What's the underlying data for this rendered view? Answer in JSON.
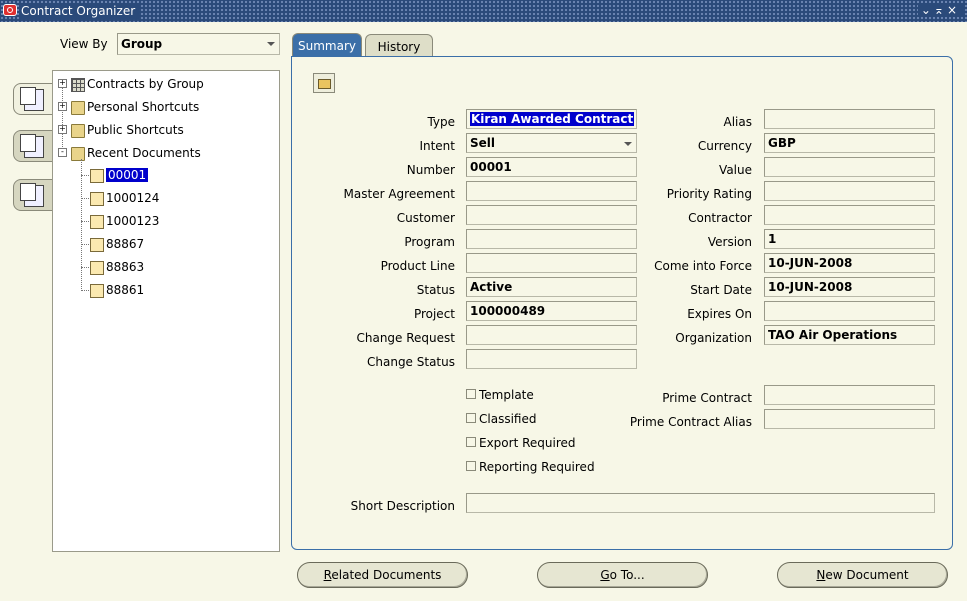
{
  "window": {
    "title": "Contract Organizer",
    "controls": "⌄⌅×"
  },
  "view_by": {
    "label": "View By",
    "value": "Group"
  },
  "tree": {
    "roots": [
      {
        "label": "Contracts by Group"
      },
      {
        "label": "Personal Shortcuts"
      },
      {
        "label": "Public Shortcuts"
      },
      {
        "label": "Recent Documents"
      }
    ],
    "recent": [
      "00001",
      "1000124",
      "1000123",
      "88867",
      "88863",
      "88861"
    ]
  },
  "tabs": {
    "summary": "Summary",
    "history": "History"
  },
  "left_fields": {
    "type": {
      "label": "Type",
      "value": "Kiran Awarded Contract"
    },
    "intent": {
      "label": "Intent",
      "value": "Sell"
    },
    "number": {
      "label": "Number",
      "value": "00001"
    },
    "master_agreement": {
      "label": "Master Agreement",
      "value": ""
    },
    "customer": {
      "label": "Customer",
      "value": ""
    },
    "program": {
      "label": "Program",
      "value": ""
    },
    "product_line": {
      "label": "Product Line",
      "value": ""
    },
    "status": {
      "label": "Status",
      "value": "Active"
    },
    "project": {
      "label": "Project",
      "value": "100000489"
    },
    "change_request": {
      "label": "Change Request",
      "value": ""
    },
    "change_status": {
      "label": "Change Status",
      "value": ""
    }
  },
  "right_fields": {
    "alias": {
      "label": "Alias",
      "value": ""
    },
    "currency": {
      "label": "Currency",
      "value": "GBP"
    },
    "value": {
      "label": "Value",
      "value": ""
    },
    "priority_rating": {
      "label": "Priority Rating",
      "value": ""
    },
    "contractor": {
      "label": "Contractor",
      "value": ""
    },
    "version": {
      "label": "Version",
      "value": "1"
    },
    "come_into_force": {
      "label": "Come into Force",
      "value": "10-JUN-2008"
    },
    "start_date": {
      "label": "Start Date",
      "value": "10-JUN-2008"
    },
    "expires_on": {
      "label": "Expires On",
      "value": ""
    },
    "organization": {
      "label": "Organization",
      "value": "TAO Air Operations"
    }
  },
  "checkboxes": {
    "template": "Template",
    "classified": "Classified",
    "export_required": "Export Required",
    "reporting_required": "Reporting Required"
  },
  "prime": {
    "contract": {
      "label": "Prime Contract",
      "value": ""
    },
    "alias": {
      "label": "Prime Contract Alias",
      "value": ""
    }
  },
  "short_description": {
    "label": "Short Description",
    "value": ""
  },
  "buttons": {
    "related_documents": {
      "mnemonic": "R",
      "rest": "elated Documents"
    },
    "go_to": {
      "mnemonic": "G",
      "rest": "o To..."
    },
    "new_document": {
      "mnemonic": "N",
      "rest": "ew Document"
    }
  }
}
